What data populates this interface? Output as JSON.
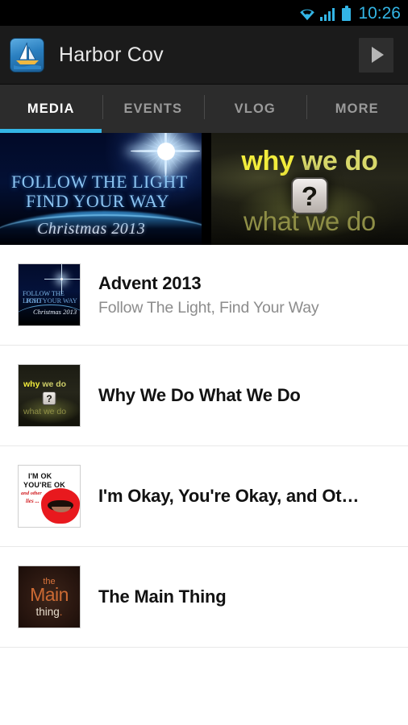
{
  "statusbar": {
    "time": "10:26",
    "icons": [
      "wifi-icon",
      "cellular-signal-icon",
      "battery-icon"
    ]
  },
  "actionbar": {
    "app_icon": "sailboat-app-icon",
    "title": "Harbor Cov",
    "play_button": "play-icon"
  },
  "tabs": [
    {
      "label": "MEDIA",
      "active": true
    },
    {
      "label": "EVENTS",
      "active": false
    },
    {
      "label": "VLOG",
      "active": false
    },
    {
      "label": "MORE",
      "active": false
    }
  ],
  "accent_color": "#33b5e5",
  "carousel": {
    "banners": [
      {
        "name": "advent-banner",
        "line1": "FOLLOW THE LIGHT",
        "line2": "FIND YOUR WAY",
        "line3": "Christmas 2013"
      },
      {
        "name": "why-we-do-banner",
        "top_highlight": "why",
        "top_rest": " we do",
        "center_glyph": "?",
        "bottom": "what we do"
      }
    ]
  },
  "list": {
    "items": [
      {
        "title": "Advent 2013",
        "subtitle": "Follow The Light, Find Your Way",
        "thumbnail": "advent-2013-thumbnail",
        "thumb_text": {
          "l1": "FOLLOW THE LIGHT",
          "l2": "FIND YOUR WAY",
          "l3": "Christmas 2013"
        }
      },
      {
        "title": "Why We Do What We Do",
        "subtitle": "",
        "thumbnail": "why-we-do-thumbnail",
        "thumb_text": {
          "hl": "why",
          "rest": " we do",
          "q": "?",
          "bottom": "what we do"
        }
      },
      {
        "title": "I'm Okay, You're Okay, and Ot…",
        "subtitle": "",
        "thumbnail": "im-okay-thumbnail",
        "thumb_text": {
          "l1": "I'M OK",
          "l2": "YOU'RE OK",
          "l3": "and other",
          "l4": "lies ..."
        }
      },
      {
        "title": "The Main Thing",
        "subtitle": "",
        "thumbnail": "the-main-thing-thumbnail",
        "thumb_text": {
          "a": "the",
          "b": "Main",
          "c": "thing",
          "dot": "."
        }
      }
    ]
  }
}
